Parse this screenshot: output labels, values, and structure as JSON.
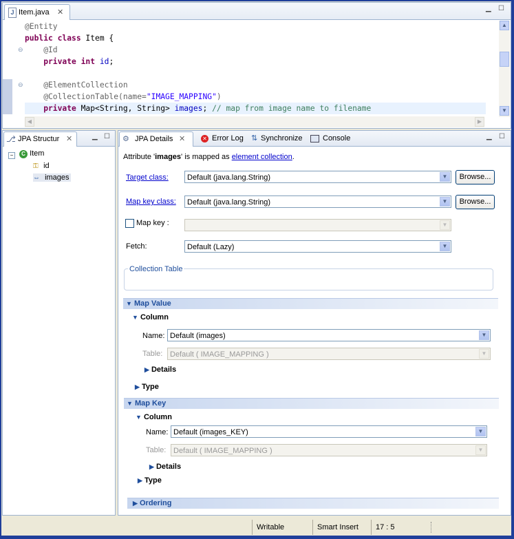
{
  "editor": {
    "tab_title": "Item.java",
    "lines": [
      {
        "ann": "@Entity"
      },
      {
        "parts": [
          {
            "t": "public ",
            "c": "kw"
          },
          {
            "t": "class ",
            "c": "kw"
          },
          {
            "t": "Item {",
            "c": ""
          }
        ]
      },
      {
        "ann": "    @Id"
      },
      {
        "parts": [
          {
            "t": "    private ",
            "c": "kw"
          },
          {
            "t": "int ",
            "c": "kw"
          },
          {
            "t": "id",
            "c": "fld"
          },
          {
            "t": ";",
            "c": ""
          }
        ]
      },
      {
        "parts": [
          {
            "t": "",
            "c": ""
          }
        ]
      },
      {
        "ann": "    @ElementCollection"
      },
      {
        "parts": [
          {
            "t": "    @CollectionTable(name=",
            "c": "ann"
          },
          {
            "t": "\"IMAGE_MAPPING\"",
            "c": "str"
          },
          {
            "t": ")",
            "c": "ann"
          }
        ]
      },
      {
        "parts": [
          {
            "t": "    private ",
            "c": "kw"
          },
          {
            "t": "Map<String, String> ",
            "c": ""
          },
          {
            "t": "images",
            "c": "fld"
          },
          {
            "t": "; ",
            "c": ""
          },
          {
            "t": "// map from image name to filename",
            "c": "cmt"
          }
        ]
      }
    ]
  },
  "left_panel": {
    "tab_title": "JPA Structur",
    "tree": {
      "root": "Item",
      "children": [
        "id",
        "images"
      ]
    }
  },
  "right_panel": {
    "tabs": [
      "JPA Details",
      "Error Log",
      "Synchronize",
      "Console"
    ],
    "attribute_prefix": "Attribute '",
    "attribute_name": "images",
    "attribute_mid": "' is mapped as ",
    "attribute_link": "element collection",
    "attribute_suffix": ".",
    "target_class_label": "Target class:",
    "target_class_value": "Default (java.lang.String)",
    "browse_label": "Browse...",
    "map_key_class_label": "Map key class:",
    "map_key_class_value": "Default (java.lang.String)",
    "map_key_label": "Map key :",
    "map_key_value": "",
    "fetch_label": "Fetch:",
    "fetch_value": "Default (Lazy)",
    "collection_table_label": "Collection Table",
    "map_value": {
      "title": "Map Value",
      "column_title": "Column",
      "name_label": "Name:",
      "name_value": "Default (images)",
      "table_label": "Table:",
      "table_value": "Default ( IMAGE_MAPPING )",
      "details_label": "Details",
      "type_label": "Type"
    },
    "map_key": {
      "title": "Map Key",
      "column_title": "Column",
      "name_label": "Name:",
      "name_value": "Default (images_KEY)",
      "table_label": "Table:",
      "table_value": "Default ( IMAGE_MAPPING )",
      "details_label": "Details",
      "type_label": "Type"
    },
    "ordering_label": "Ordering"
  },
  "status_bar": {
    "writable": "Writable",
    "insert_mode": "Smart Insert",
    "position": "17 : 5"
  }
}
